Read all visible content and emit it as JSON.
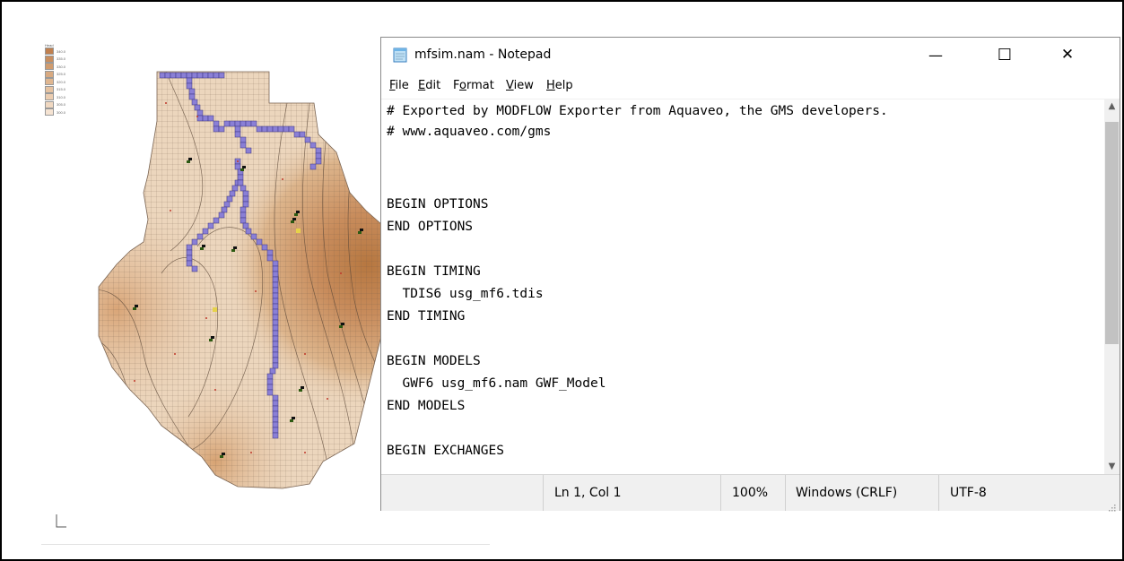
{
  "legend": {
    "title": "Head",
    "items": [
      {
        "label": "340.0",
        "color": "#c0804f"
      },
      {
        "label": "335.0",
        "color": "#c88e5f"
      },
      {
        "label": "330.0",
        "color": "#d09c6f"
      },
      {
        "label": "325.0",
        "color": "#d8a980"
      },
      {
        "label": "320.0",
        "color": "#dfb690"
      },
      {
        "label": "315.0",
        "color": "#e5c2a1"
      },
      {
        "label": "310.0",
        "color": "#ebcdb1"
      },
      {
        "label": "305.0",
        "color": "#f0d8c1"
      },
      {
        "label": "300.0",
        "color": "#f5e3d2"
      }
    ]
  },
  "colors": {
    "map_light": "#ecd6bd",
    "map_mid": "#ddb58c",
    "map_dark": "#c88c5c",
    "stream_cells": "#8a7fd6",
    "grid_line": "#6e5a48"
  },
  "notepad": {
    "title": "mfsim.nam - Notepad",
    "menu": [
      {
        "label": "File",
        "ul": "F",
        "rest": "ile"
      },
      {
        "label": "Edit",
        "ul": "E",
        "rest": "dit"
      },
      {
        "label": "Format",
        "pre": "F",
        "ul": "o",
        "rest": "rmat"
      },
      {
        "label": "View",
        "ul": "V",
        "rest": "iew"
      },
      {
        "label": "Help",
        "ul": "H",
        "rest": "elp"
      }
    ],
    "lines": [
      "# Exported by MODFLOW Exporter from Aquaveo, the GMS developers.",
      "# www.aquaveo.com/gms",
      "",
      "",
      "BEGIN OPTIONS",
      "END OPTIONS",
      "",
      "BEGIN TIMING",
      "  TDIS6 usg_mf6.tdis",
      "END TIMING",
      "",
      "BEGIN MODELS",
      "  GWF6 usg_mf6.nam GWF_Model",
      "END MODELS",
      "",
      "BEGIN EXCHANGES"
    ],
    "status": {
      "position": "Ln 1, Col 1",
      "zoom": "100%",
      "line_ending": "Windows (CRLF)",
      "encoding": "UTF-8"
    },
    "buttons": {
      "minimize": "—",
      "maximize": "☐",
      "close": "✕"
    }
  }
}
